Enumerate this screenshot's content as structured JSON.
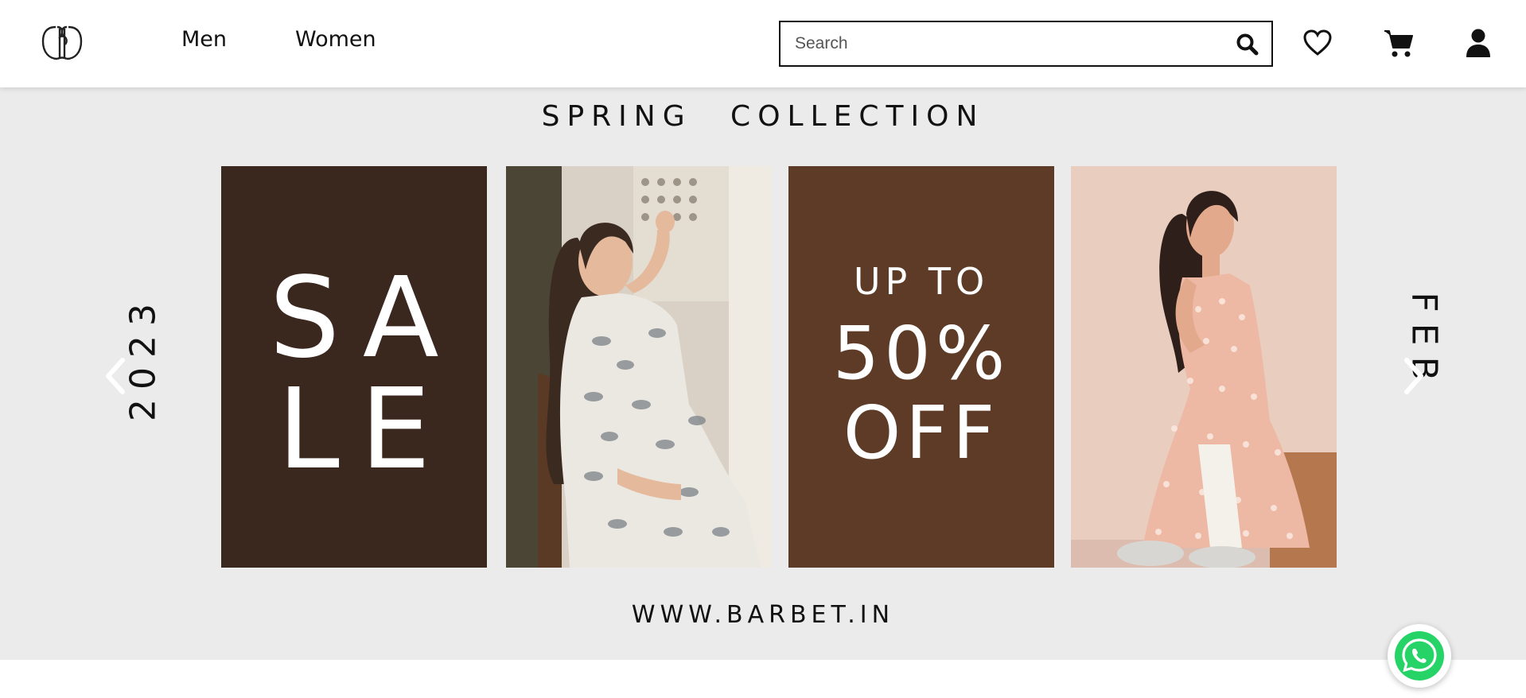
{
  "header": {
    "nav": [
      {
        "label": "Men"
      },
      {
        "label": "Women"
      }
    ],
    "search": {
      "placeholder": "Search",
      "value": ""
    },
    "icons": [
      "logo-icon",
      "search-icon",
      "heart-icon",
      "cart-icon",
      "user-icon"
    ]
  },
  "hero": {
    "title": "SPRING COLLECTION",
    "side_left": "2023",
    "side_right": "FEB",
    "url": "WWW.BARBET.IN",
    "panels": {
      "sale_line_1": "SA",
      "sale_line_2": "LE",
      "promo_small": "UP TO",
      "promo_big_1": "50%",
      "promo_big_2": "OFF"
    },
    "colors": {
      "panel_dark": "#3a281f",
      "panel_brown": "#5e3b27",
      "background": "#ebebeb"
    }
  },
  "floating": {
    "icon": "whatsapp-icon"
  }
}
